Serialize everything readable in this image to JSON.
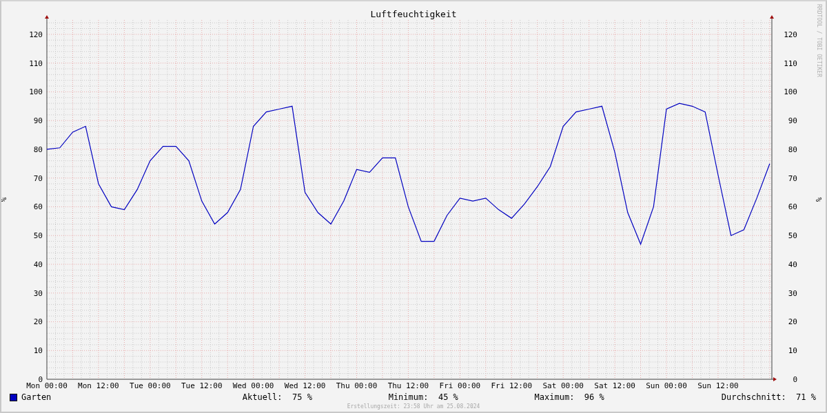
{
  "chart_data": {
    "type": "line",
    "title": "Luftfeuchtigkeit",
    "ylabel": "%",
    "categories": [
      "Mon 00:00",
      null,
      null,
      null,
      "Mon 12:00",
      null,
      null,
      null,
      "Tue 00:00",
      null,
      null,
      null,
      "Tue 12:00",
      null,
      null,
      null,
      "Wed 00:00",
      null,
      null,
      null,
      "Wed 12:00",
      null,
      null,
      null,
      "Thu 00:00",
      null,
      null,
      null,
      "Thu 12:00",
      null,
      null,
      null,
      "Fri 00:00",
      null,
      null,
      null,
      "Fri 12:00",
      null,
      null,
      null,
      "Sat 00:00",
      null,
      null,
      null,
      "Sat 12:00",
      null,
      null,
      null,
      "Sun 00:00",
      null,
      null,
      null,
      "Sun 12:00",
      null,
      null,
      null,
      null
    ],
    "series": [
      {
        "name": "Garten",
        "color": "#0000c0",
        "values": [
          80,
          80.5,
          86,
          88,
          68,
          60,
          59,
          66,
          76,
          81,
          81,
          76,
          62,
          54,
          58,
          66,
          88,
          93,
          94,
          95,
          65,
          58,
          54,
          62,
          73,
          72,
          77,
          77,
          60,
          48,
          48,
          57,
          63,
          62,
          63,
          59,
          56,
          61,
          67,
          74,
          88,
          93,
          94,
          95,
          79,
          58,
          47,
          60,
          94,
          96,
          95,
          93,
          71,
          50,
          52,
          63,
          75
        ]
      }
    ],
    "ylim": [
      0,
      125
    ],
    "grid": true,
    "yticks": [
      0,
      10,
      20,
      30,
      40,
      50,
      60,
      70,
      80,
      90,
      100,
      110,
      120
    ]
  },
  "right_axis": {
    "label": "%",
    "ticks": [
      "120",
      "110",
      "100",
      "90",
      "80",
      "70",
      "60",
      "50",
      "40",
      "30",
      "20",
      "10",
      "0"
    ]
  },
  "credit": "RRDTOOL / TOBI OETIKER",
  "legend": {
    "stats": [
      {
        "label": "Aktuell:",
        "value": "75 %"
      },
      {
        "label": "Minimum:",
        "value": "45 %"
      },
      {
        "label": "Maximum:",
        "value": "96 %"
      },
      {
        "label": "Durchschnitt:",
        "value": "71 %"
      }
    ]
  },
  "footer": "Erstellungszeit: 23:58 Uhr am 25.08.2024"
}
